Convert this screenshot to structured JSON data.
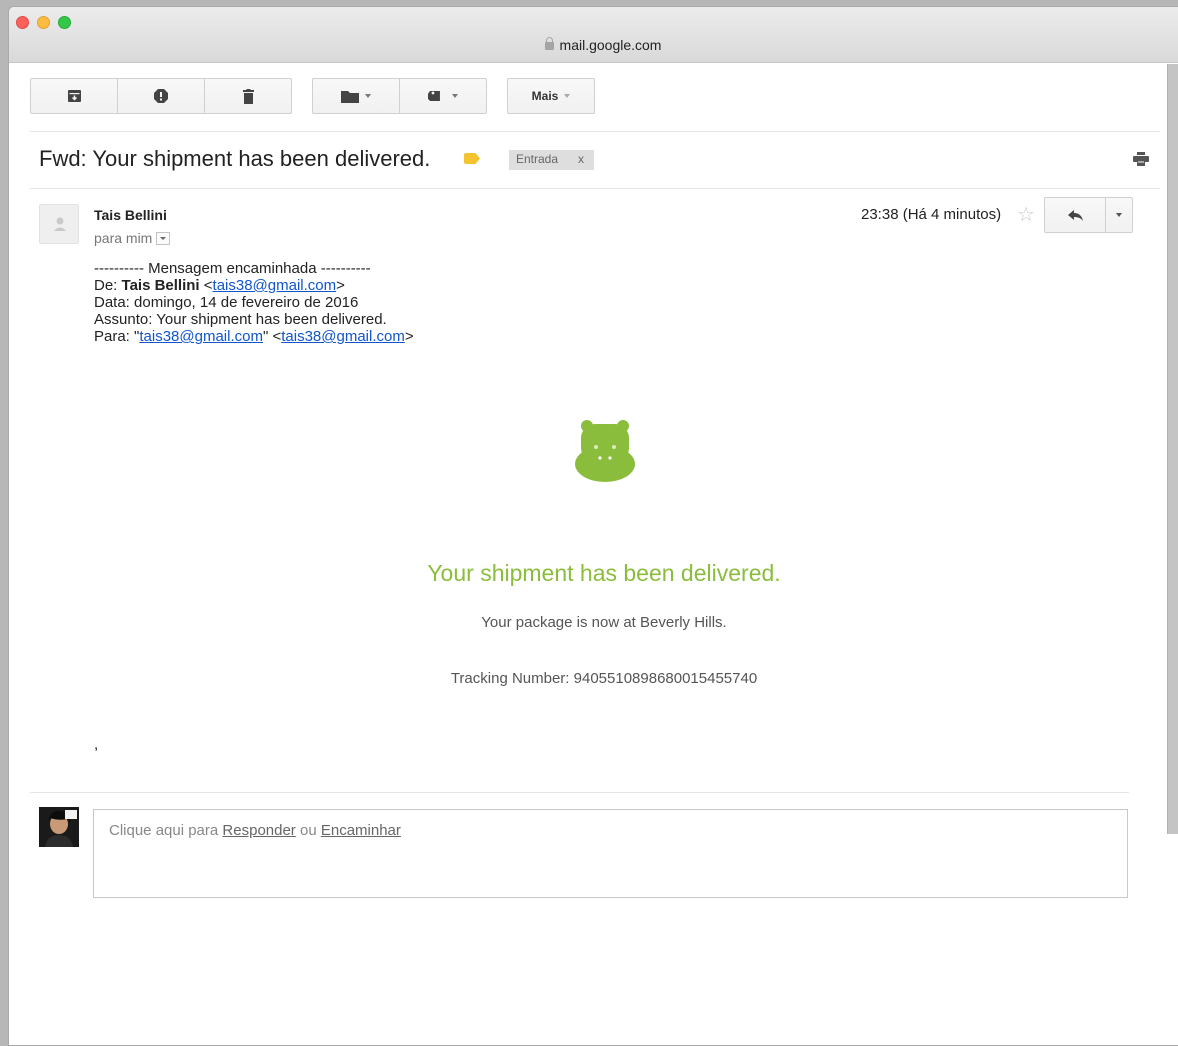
{
  "browser": {
    "url": "mail.google.com"
  },
  "toolbar": {
    "archive_icon": "archive-icon",
    "spam_icon": "report-spam-icon",
    "delete_icon": "trash-icon",
    "move_icon": "folder-icon",
    "labels_icon": "label-icon",
    "more_label": "Mais"
  },
  "email": {
    "subject": "Fwd: Your shipment has been delivered.",
    "label_chip": "Entrada",
    "label_remove": "x",
    "sender_name": "Tais Bellini",
    "to_line": "para mim",
    "time": "23:38 (Há 4 minutos)",
    "forwarded": {
      "header": "---------- Mensagem encaminhada ----------",
      "from_label": "De: ",
      "from_name": "Tais Bellini",
      "from_email": "tais38@gmail.com",
      "date_line": "Data: domingo, 14 de fevereiro de 2016",
      "subject_line": "Assunto: Your shipment has been delivered.",
      "to_label": "Para: ",
      "to_name": "tais38@gmail.com",
      "to_email": "tais38@gmail.com"
    },
    "body": {
      "headline": "Your shipment has been delivered.",
      "location": "Your package is now at Beverly Hills.",
      "tracking": "Tracking Number: 9405510898680015455740",
      "trailing": ","
    },
    "accent_color": "#8bbd3c"
  },
  "reply": {
    "prefix": "Clique aqui para ",
    "reply_link": "Responder",
    "middle": " ou ",
    "forward_link": "Encaminhar"
  }
}
